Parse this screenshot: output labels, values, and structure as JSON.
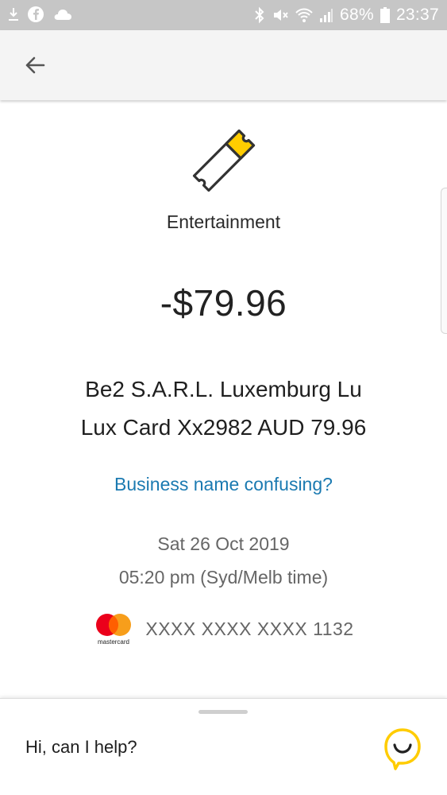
{
  "status_bar": {
    "battery": "68%",
    "time": "23:37",
    "icons": [
      "download-icon",
      "facebook-icon",
      "cloud-icon",
      "bluetooth-icon",
      "mute-icon",
      "wifi-icon",
      "signal-icon",
      "battery-icon"
    ]
  },
  "app_bar": {
    "back_icon": "arrow-left-icon"
  },
  "transaction": {
    "category": "Entertainment",
    "category_icon": "ticket-icon",
    "amount": "-$79.96",
    "merchant_line1": "Be2 S.A.R.L. Luxemburg Lu",
    "merchant_line2": "Lux Card Xx2982 AUD 79.96",
    "confusing_link": "Business name confusing?",
    "date": "Sat 26 Oct 2019",
    "time": "05:20 pm (Syd/Melb time)",
    "card_brand": "mastercard",
    "card_number": "XXXX XXXX XXXX 1132"
  },
  "assistant": {
    "prompt": "Hi, can I help?",
    "icon": "chat-assistant-icon"
  },
  "colors": {
    "status_bar": "#c6c6c6",
    "app_bar": "#f4f4f4",
    "link": "#1b7ab1",
    "accent_yellow": "#ffcc00",
    "mc_red": "#eb001b",
    "mc_orange": "#f79e1b"
  }
}
